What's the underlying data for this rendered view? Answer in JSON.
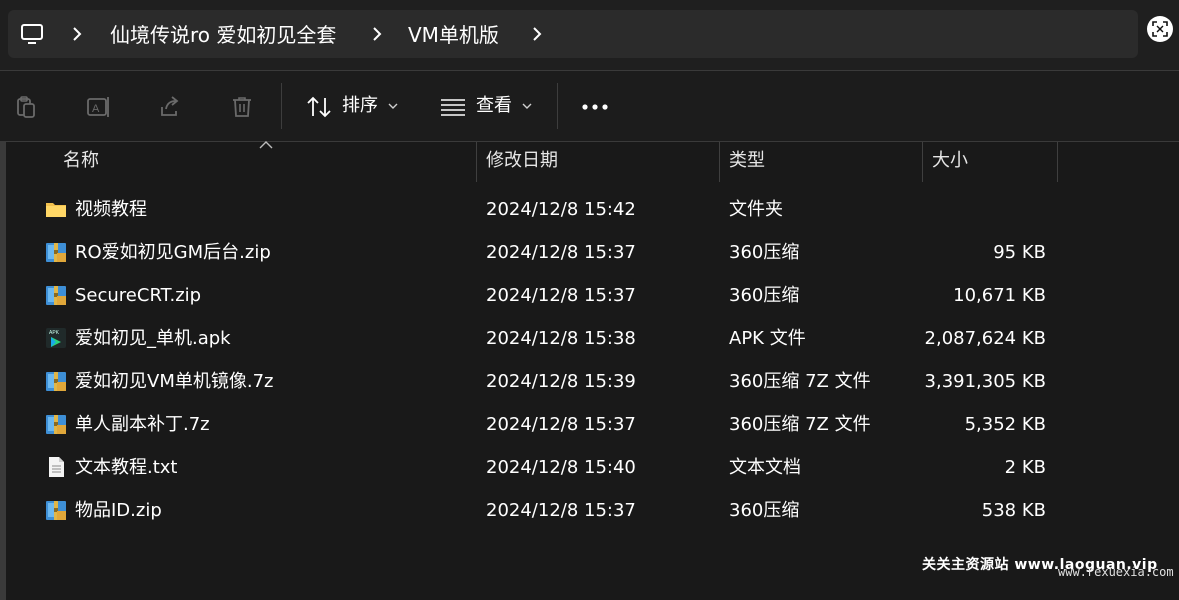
{
  "addressbar": {
    "icons": {
      "computer": "monitor-icon",
      "separator": "chevron-right-icon",
      "scan": "scan-icon"
    },
    "breadcrumbs": [
      "仙境传说ro 爱如初见全套",
      "VM单机版"
    ]
  },
  "toolbar": {
    "icons": [
      "clipboard-icon",
      "rename-icon",
      "share-icon",
      "trash-icon",
      "sort-icon",
      "view-icon",
      "more-icon"
    ],
    "sort_label": "排序",
    "view_label": "查看"
  },
  "columns": {
    "name": "名称",
    "modified": "修改日期",
    "type": "类型",
    "size": "大小"
  },
  "files": [
    {
      "icon": "folder-icon",
      "name": "视频教程",
      "modified": "2024/12/8 15:42",
      "type": "文件夹",
      "size": ""
    },
    {
      "icon": "archive-icon",
      "name": "RO爱如初见GM后台.zip",
      "modified": "2024/12/8 15:37",
      "type": "360压缩",
      "size": "95 KB"
    },
    {
      "icon": "archive-icon",
      "name": "SecureCRT.zip",
      "modified": "2024/12/8 15:37",
      "type": "360压缩",
      "size": "10,671 KB"
    },
    {
      "icon": "apk-icon",
      "name": "爱如初见_单机.apk",
      "modified": "2024/12/8 15:38",
      "type": "APK 文件",
      "size": "2,087,624 KB"
    },
    {
      "icon": "archive-icon",
      "name": "爱如初见VM单机镜像.7z",
      "modified": "2024/12/8 15:39",
      "type": "360压缩 7Z 文件",
      "size": "3,391,305 KB"
    },
    {
      "icon": "archive-icon",
      "name": "单人副本补丁.7z",
      "modified": "2024/12/8 15:37",
      "type": "360压缩 7Z 文件",
      "size": "5,352 KB"
    },
    {
      "icon": "text-file-icon",
      "name": "文本教程.txt",
      "modified": "2024/12/8 15:40",
      "type": "文本文档",
      "size": "2 KB"
    },
    {
      "icon": "archive-icon",
      "name": "物品ID.zip",
      "modified": "2024/12/8 15:37",
      "type": "360压缩",
      "size": "538 KB"
    }
  ],
  "watermark": {
    "text": "关关主资源站 www.laoguan.vip",
    "text2": "www.rexuexia.com"
  }
}
